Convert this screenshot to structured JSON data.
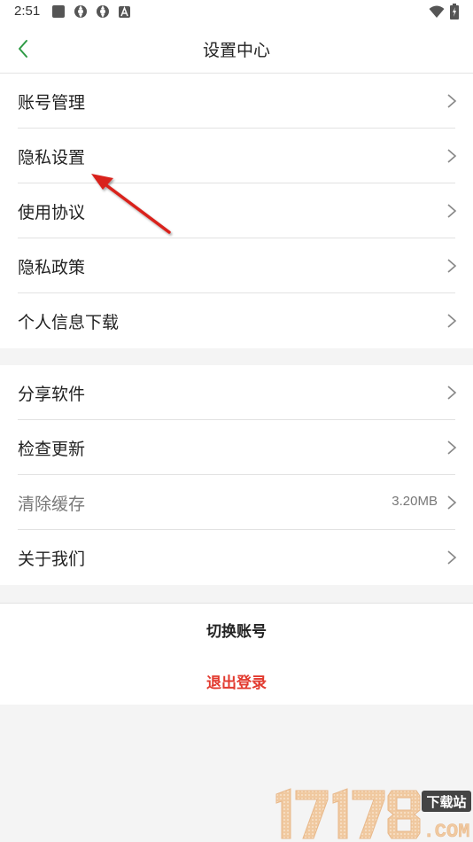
{
  "status_bar": {
    "time": "2:51",
    "icons": [
      "app-square-icon",
      "gear-sync-icon",
      "gear-sync-icon",
      "a-badge-icon",
      "wifi-icon",
      "battery-icon"
    ]
  },
  "header": {
    "title": "设置中心",
    "back_icon": "chevron-left-icon"
  },
  "settings_group_1": {
    "items": [
      {
        "label": "账号管理"
      },
      {
        "label": "隐私设置"
      },
      {
        "label": "使用协议"
      },
      {
        "label": "隐私政策"
      },
      {
        "label": "个人信息下载"
      }
    ]
  },
  "settings_group_2": {
    "items": [
      {
        "label": "分享软件"
      },
      {
        "label": "检查更新"
      },
      {
        "label": "清除缓存",
        "value": "3.20MB"
      },
      {
        "label": "关于我们"
      }
    ]
  },
  "actions": {
    "switch_account": "切换账号",
    "logout": "退出登录"
  },
  "colors": {
    "accent_green": "#2e9b45",
    "logout_red": "#e23a2f",
    "annotation_red": "#d9231d",
    "background": "#f4f4f4"
  },
  "watermark": {
    "text_main": "17178",
    "text_badge": "下载站",
    "text_domain": ".COM"
  }
}
